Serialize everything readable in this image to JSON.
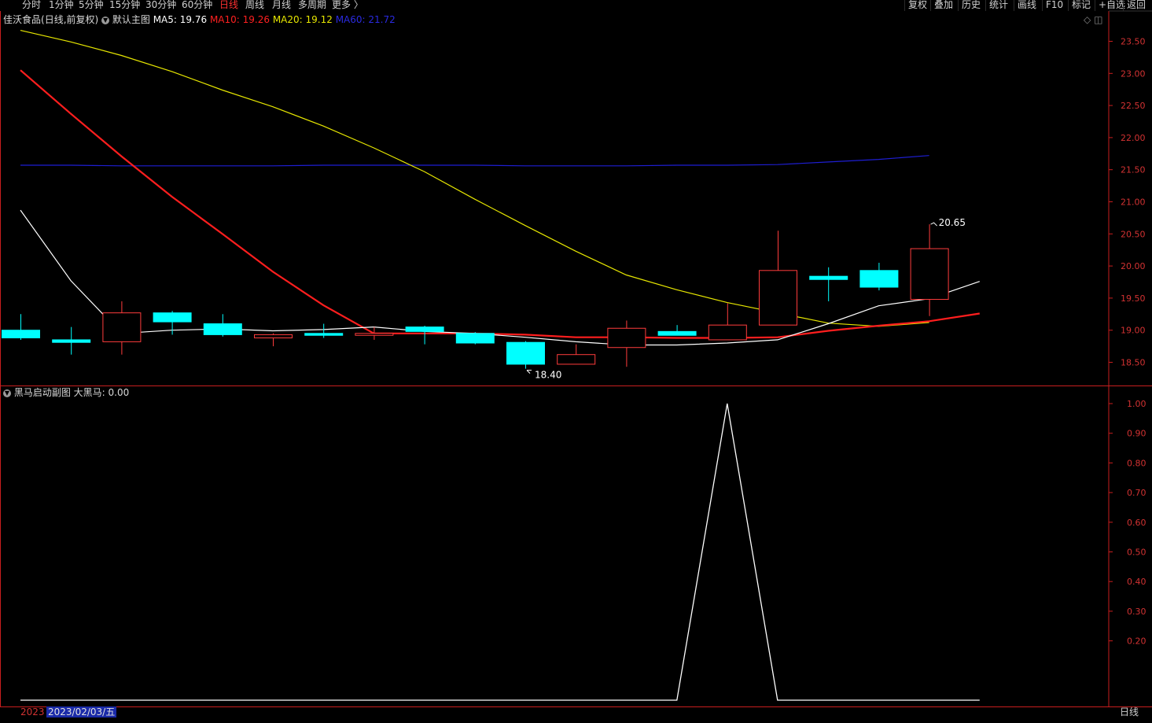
{
  "toolbar": {
    "periods": [
      "分时",
      "1分钟",
      "5分钟",
      "15分钟",
      "30分钟",
      "60分钟",
      "日线",
      "周线",
      "月线",
      "多周期",
      "更多 〉"
    ],
    "active_period": "日线",
    "right_buttons": [
      "复权",
      "叠加",
      "历史",
      "统计",
      "画线",
      "F10",
      "+自选",
      "返回"
    ],
    "right_extra": "标记"
  },
  "main_info": {
    "stock": "佳沃食品",
    "mode": "(日线,前复权)",
    "indicator": "默认主图",
    "ma5_label": "MA5: 19.76",
    "ma10_label": "MA10: 19.26",
    "ma20_label": "MA20: 19.12",
    "ma60_label": "MA60: 21.72"
  },
  "sub_info": {
    "indicator": "黑马启动副图",
    "value_label": "大黑马: 0.00"
  },
  "bottom": {
    "date_prefix": "2023",
    "cursor_date": "2023/02/03/五",
    "period_label": "日线"
  },
  "colors": {
    "up": "#ff3c3c",
    "down": "#00ffff",
    "ma5": "#ffffff",
    "ma10": "#ff1e1e",
    "ma20": "#e6e600",
    "ma60": "#1e1ed2",
    "axis": "#c81e1e"
  },
  "chart_data": [
    {
      "type": "candlestick",
      "title": "默认主图",
      "ylim": [
        18.2,
        23.75
      ],
      "y_ticks": [
        18.5,
        19.0,
        19.5,
        20.0,
        20.5,
        21.0,
        21.5,
        22.0,
        22.5,
        23.0,
        23.5
      ],
      "annotations": [
        {
          "label": "20.65",
          "candle_index": 18,
          "value": 20.65
        },
        {
          "label": "18.40",
          "candle_index": 10,
          "value": 18.4
        }
      ],
      "candles": [
        {
          "o": 19.0,
          "c": 18.88,
          "h": 19.25,
          "l": 18.85
        },
        {
          "o": 18.85,
          "c": 18.81,
          "h": 19.05,
          "l": 18.62
        },
        {
          "o": 18.82,
          "c": 19.27,
          "h": 19.45,
          "l": 18.62
        },
        {
          "o": 19.27,
          "c": 19.13,
          "h": 19.3,
          "l": 18.93
        },
        {
          "o": 19.1,
          "c": 18.93,
          "h": 19.25,
          "l": 18.9
        },
        {
          "o": 18.88,
          "c": 18.93,
          "h": 18.95,
          "l": 18.75
        },
        {
          "o": 18.95,
          "c": 18.92,
          "h": 19.1,
          "l": 18.88
        },
        {
          "o": 18.92,
          "c": 18.95,
          "h": 19.05,
          "l": 18.85
        },
        {
          "o": 19.05,
          "c": 18.98,
          "h": 19.07,
          "l": 18.78
        },
        {
          "o": 18.95,
          "c": 18.8,
          "h": 18.97,
          "l": 18.78
        },
        {
          "o": 18.81,
          "c": 18.47,
          "h": 18.83,
          "l": 18.4
        },
        {
          "o": 18.47,
          "c": 18.62,
          "h": 18.78,
          "l": 18.47
        },
        {
          "o": 18.73,
          "c": 19.03,
          "h": 19.15,
          "l": 18.43
        },
        {
          "o": 18.98,
          "c": 18.92,
          "h": 19.08,
          "l": 18.92
        },
        {
          "o": 18.85,
          "c": 19.08,
          "h": 19.42,
          "l": 18.85
        },
        {
          "o": 19.08,
          "c": 19.93,
          "h": 20.55,
          "l": 19.08
        },
        {
          "o": 19.84,
          "c": 19.79,
          "h": 19.98,
          "l": 19.45
        },
        {
          "o": 19.93,
          "c": 19.67,
          "h": 20.05,
          "l": 19.62
        },
        {
          "o": 19.48,
          "c": 20.27,
          "h": 20.65,
          "l": 19.22
        }
      ],
      "ma5": [
        20.87,
        19.77,
        18.95,
        19.0,
        19.02,
        18.99,
        19.01,
        19.05,
        18.98,
        18.95,
        18.89,
        18.82,
        18.77,
        18.77,
        18.8,
        18.85,
        19.1,
        19.38,
        19.49,
        19.76
      ],
      "ma10": [
        23.05,
        22.37,
        21.71,
        21.08,
        20.5,
        19.91,
        19.39,
        18.95,
        18.95,
        18.95,
        18.93,
        18.89,
        18.89,
        18.88,
        18.88,
        18.89,
        18.99,
        19.07,
        19.14,
        19.26
      ],
      "ma20": [
        23.67,
        23.49,
        23.28,
        23.03,
        22.74,
        22.48,
        22.18,
        21.84,
        21.47,
        21.04,
        20.63,
        20.23,
        19.86,
        19.63,
        19.43,
        19.27,
        19.11,
        19.06,
        19.12
      ],
      "ma60": [
        21.57,
        21.57,
        21.56,
        21.56,
        21.56,
        21.56,
        21.57,
        21.57,
        21.57,
        21.57,
        21.56,
        21.56,
        21.56,
        21.57,
        21.57,
        21.58,
        21.62,
        21.66,
        21.72
      ]
    },
    {
      "type": "line",
      "title": "黑马启动副图",
      "series": [
        {
          "name": "大黑马",
          "values": [
            0,
            0,
            0,
            0,
            0,
            0,
            0,
            0,
            0,
            0,
            0,
            0,
            0,
            0,
            1.0,
            0,
            0,
            0,
            0,
            0
          ]
        }
      ],
      "ylim": [
        0,
        1.0
      ],
      "y_ticks": [
        0.2,
        0.3,
        0.4,
        0.5,
        0.6,
        0.7,
        0.8,
        0.9,
        1.0
      ]
    }
  ]
}
